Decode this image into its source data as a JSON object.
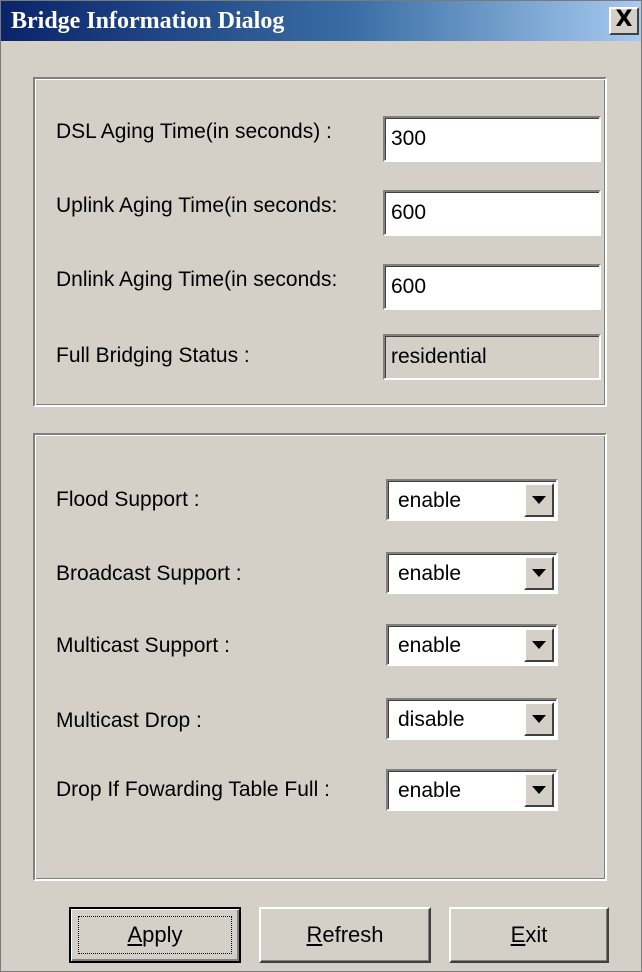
{
  "window": {
    "title": "Bridge Information Dialog",
    "close_label": "X"
  },
  "aging_group": {
    "dsl_label": "DSL Aging  Time(in seconds) :",
    "dsl_value": "300",
    "uplink_label": "Uplink Aging Time(in seconds:",
    "uplink_value": "600",
    "dnlink_label": "Dnlink Aging Time(in seconds:",
    "dnlink_value": "600",
    "full_bridging_label": "Full Bridging Status :",
    "full_bridging_value": "residential"
  },
  "support_group": {
    "flood_label": "Flood Support :",
    "flood_value": "enable",
    "broadcast_label": "Broadcast Support :",
    "broadcast_value": "enable",
    "multicast_label": "Multicast Support :",
    "multicast_value": "enable",
    "multicast_drop_label": "Multicast Drop :",
    "multicast_drop_value": "disable",
    "drop_fwd_label": "Drop If Fowarding Table Full :",
    "drop_fwd_value": "enable"
  },
  "buttons": {
    "apply_mnemonic": "A",
    "apply_rest": "pply",
    "refresh_mnemonic": "R",
    "refresh_rest": "efresh",
    "exit_mnemonic": "E",
    "exit_rest": "xit"
  },
  "icons": {
    "dropdown": "chevron-down-icon",
    "close": "close-icon"
  }
}
